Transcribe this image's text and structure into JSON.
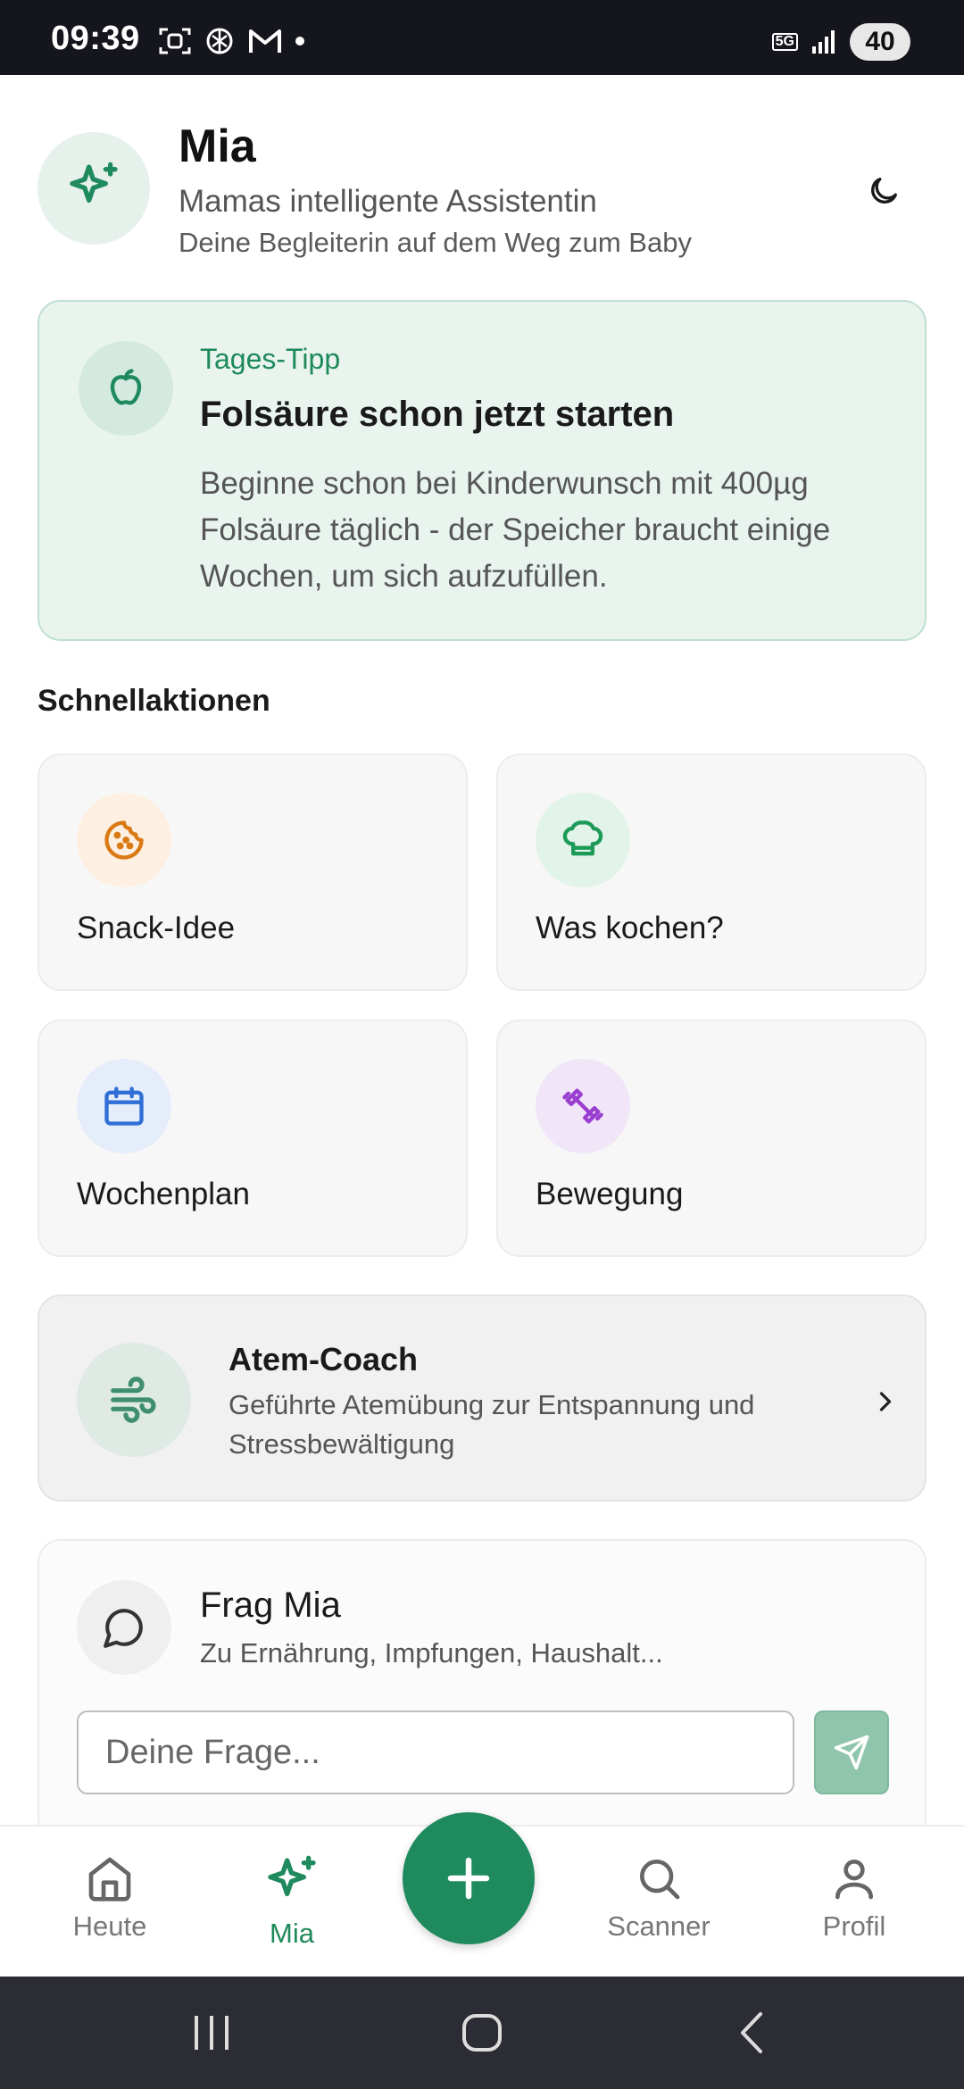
{
  "status_bar": {
    "time": "09:39",
    "network": "5G",
    "battery": "40"
  },
  "header": {
    "title": "Mia",
    "subtitle": "Mamas intelligente Assistentin",
    "tagline": "Deine Begleiterin auf dem Weg zum Baby"
  },
  "tip": {
    "label": "Tages-Tipp",
    "title": "Folsäure schon jetzt starten",
    "text": "Beginne schon bei Kinderwunsch mit 400µg Folsäure täglich - der Speicher braucht einige Wochen, um sich aufzufüllen."
  },
  "quick_actions": {
    "title": "Schnellaktionen",
    "items": [
      {
        "label": "Snack-Idee",
        "icon": "cookie-icon",
        "bg": "#fdf0e2",
        "color": "#d97a15"
      },
      {
        "label": "Was kochen?",
        "icon": "chef-hat-icon",
        "bg": "#e2f3e9",
        "color": "#1e9a58"
      },
      {
        "label": "Wochenplan",
        "icon": "calendar-icon",
        "bg": "#e5edfa",
        "color": "#2f6ed6"
      },
      {
        "label": "Bewegung",
        "icon": "dumbbell-icon",
        "bg": "#f1e6f8",
        "color": "#9b3fd0"
      }
    ]
  },
  "breath_coach": {
    "title": "Atem-Coach",
    "text": "Geführte Atemübung zur Entspannung und Stressbewältigung"
  },
  "ask": {
    "title": "Frag Mia",
    "subtitle": "Zu Ernährung, Impfungen, Haushalt...",
    "placeholder": "Deine Frage..."
  },
  "nav": {
    "items": [
      {
        "label": "Heute",
        "icon": "home-icon"
      },
      {
        "label": "Mia",
        "icon": "sparkles-icon",
        "active": true
      },
      {
        "label": "Scanner",
        "icon": "search-icon"
      },
      {
        "label": "Profil",
        "icon": "user-icon"
      }
    ]
  },
  "colors": {
    "brand": "#1e8a5e",
    "tip_bg": "#e9f4ef"
  }
}
